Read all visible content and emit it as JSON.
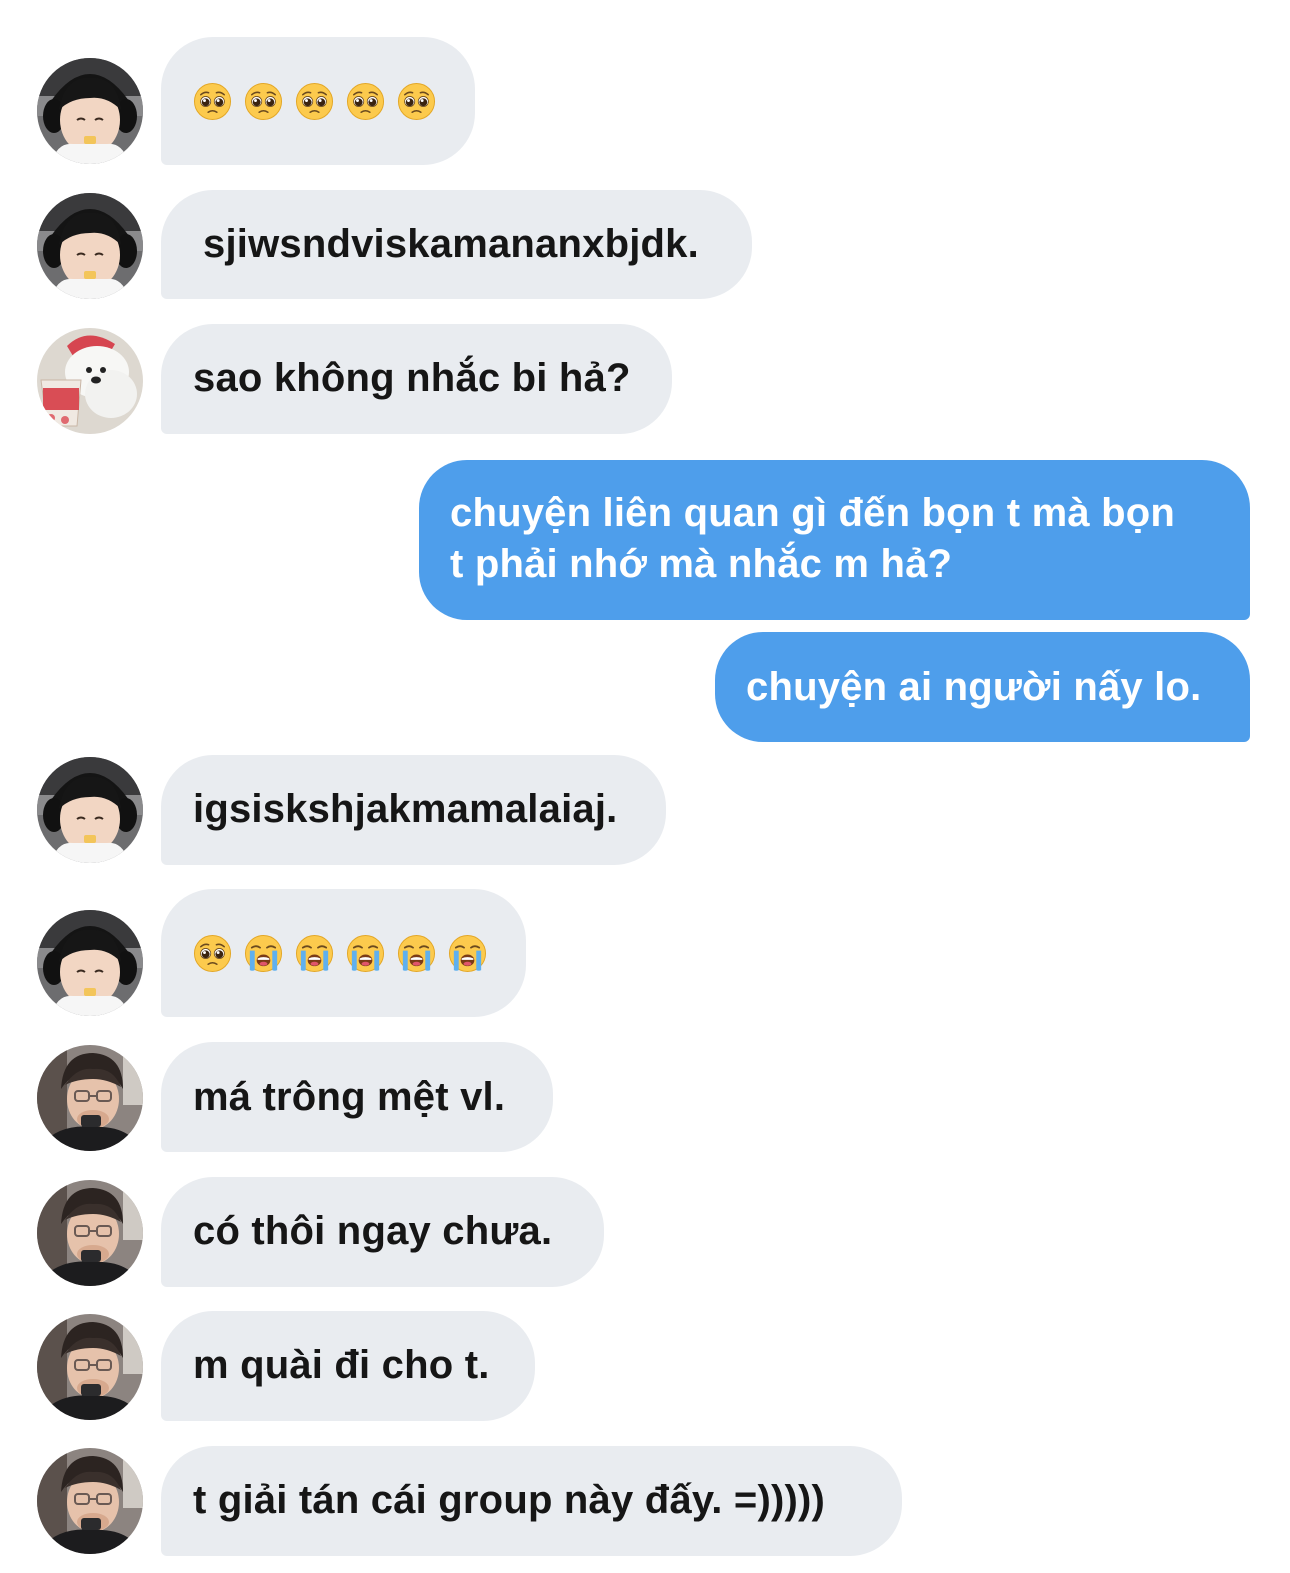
{
  "conversation": {
    "messages": [
      {
        "sender": "other",
        "avatar": "avatar-headphones",
        "emojis": [
          "pleading-face-emoji",
          "pleading-face-emoji",
          "pleading-face-emoji",
          "pleading-face-emoji",
          "pleading-face-emoji"
        ]
      },
      {
        "sender": "other",
        "avatar": "avatar-headphones",
        "text": "sjiwsndviskamananxbjdk."
      },
      {
        "sender": "other",
        "avatar": "avatar-bear",
        "text": "sao không nhắc bi hả?"
      },
      {
        "sender": "me",
        "text_line1": "chuyện liên quan gì đến bọn t mà bọn",
        "text_line2": "t phải nhớ mà nhắc m hả?"
      },
      {
        "sender": "me",
        "text": "chuyện ai người nấy lo."
      },
      {
        "sender": "other",
        "avatar": "avatar-headphones",
        "text": "igsiskshjakmamalaiaj."
      },
      {
        "sender": "other",
        "avatar": "avatar-headphones",
        "emojis": [
          "pleading-face-emoji",
          "loudly-crying-face-emoji",
          "loudly-crying-face-emoji",
          "loudly-crying-face-emoji",
          "loudly-crying-face-emoji",
          "loudly-crying-face-emoji"
        ]
      },
      {
        "sender": "other",
        "avatar": "avatar-glasses",
        "text": "má trông mệt vl."
      },
      {
        "sender": "other",
        "avatar": "avatar-glasses",
        "text": "có thôi ngay chưa."
      },
      {
        "sender": "other",
        "avatar": "avatar-glasses",
        "text": "m quài đi cho t."
      },
      {
        "sender": "other",
        "avatar": "avatar-glasses",
        "text": "t giải tán cái group này đấy. =)))))"
      }
    ]
  },
  "colors": {
    "incoming_bubble": "#e9ecf0",
    "outgoing_bubble": "#4e9eeb",
    "incoming_text": "#161616",
    "outgoing_text": "#ffffff"
  }
}
